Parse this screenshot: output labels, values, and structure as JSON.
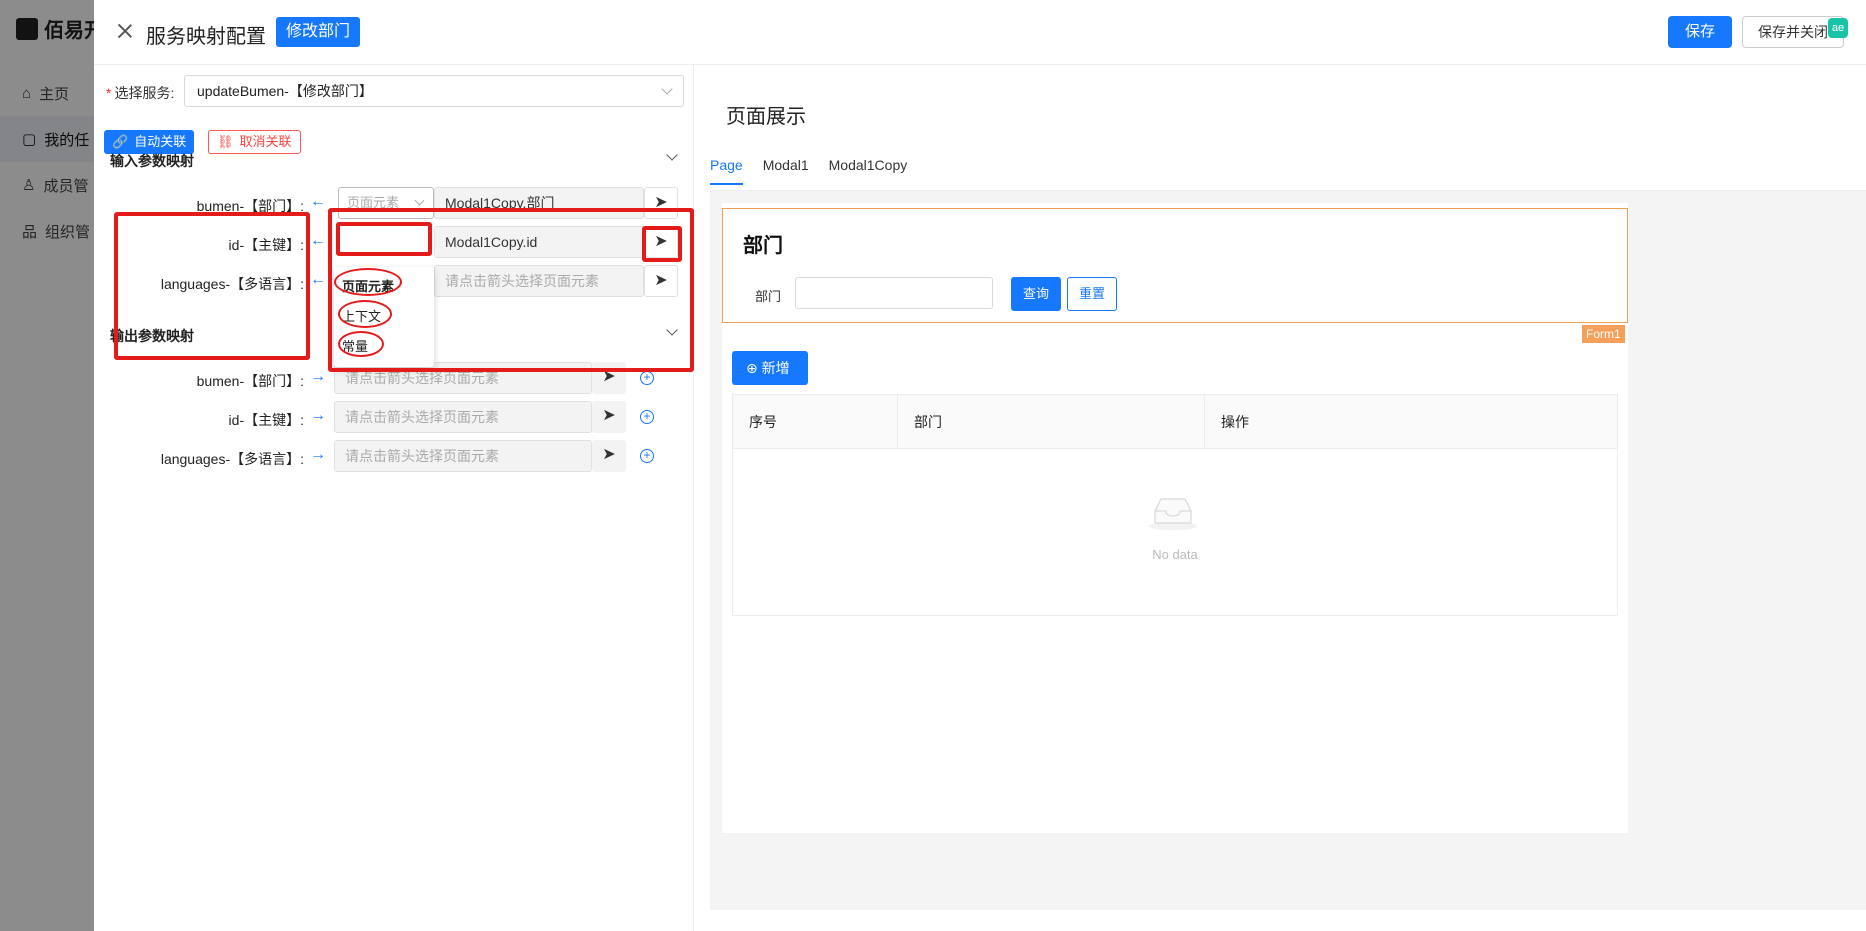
{
  "app": {
    "brand": "佰易开",
    "nav": [
      {
        "label": "主页"
      },
      {
        "label": "我的任"
      },
      {
        "label": "成员管"
      },
      {
        "label": "组织管"
      }
    ]
  },
  "drawer": {
    "title": "服务映射配置",
    "title_tag": "修改部门",
    "save_label": "保存",
    "save_close_label": "保存并关闭",
    "badge": "ae"
  },
  "left": {
    "service_label": "选择服务:",
    "service_value": "updateBumen-【修改部门】",
    "auto_link_label": "自动关联",
    "cancel_link_label": "取消关联",
    "input_section_title": "输入参数映射",
    "output_section_title": "输出参数映射",
    "input_params": [
      {
        "label": "bumen-【部门】:",
        "type": "页面元素",
        "value": "Modal1Copy.部门"
      },
      {
        "label": "id-【主键】:",
        "value": "Modal1Copy.id"
      },
      {
        "label": "languages-【多语言】:",
        "placeholder": "请点击箭头选择页面元素"
      }
    ],
    "type_options": [
      "页面元素",
      "上下文",
      "常量"
    ],
    "output_params": [
      {
        "label": "bumen-【部门】:",
        "placeholder": "请点击箭头选择页面元素"
      },
      {
        "label": "id-【主键】:",
        "placeholder": "请点击箭头选择页面元素"
      },
      {
        "label": "languages-【多语言】:",
        "placeholder": "请点击箭头选择页面元素"
      }
    ]
  },
  "right": {
    "title": "页面展示",
    "tabs": [
      "Page",
      "Modal1",
      "Modal1Copy"
    ],
    "form": {
      "title": "部门",
      "field_label": "部门",
      "query_label": "查询",
      "reset_label": "重置",
      "tag": "Form1"
    },
    "add_label": "新增",
    "table_headers": [
      "序号",
      "部门",
      "操作"
    ],
    "empty_text": "No data"
  },
  "colors": {
    "primary": "#1677ff",
    "annotation": "#e51b1b",
    "form_border": "#f0a050"
  }
}
